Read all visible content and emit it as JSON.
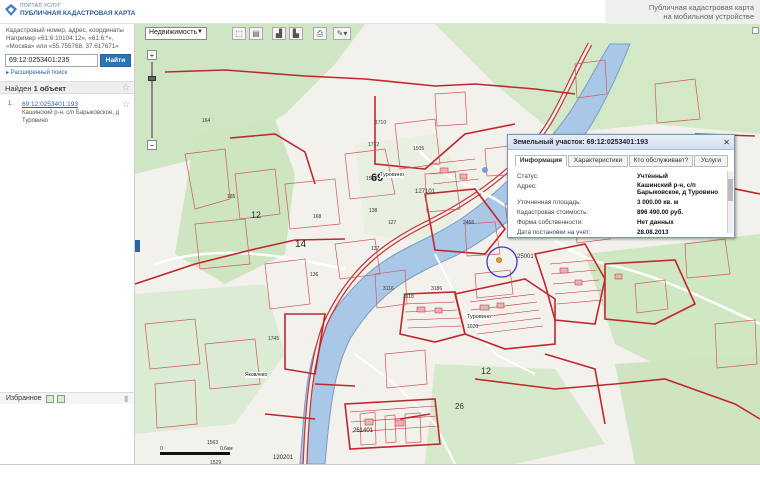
{
  "header": {
    "logo_small": "ПОРТАЛ УСЛУГ",
    "logo_big": "ПУБЛИЧНАЯ КАДАСТРОВАЯ КАРТА",
    "mobile_line1": "Публичная кадастровая карта",
    "mobile_line2": "на мобильном устройстве"
  },
  "search": {
    "hint_line1": "Кадастровый номер, адрес, координаты",
    "hint_line2": "Например «61:6:10104:12», «61:6:*»,",
    "hint_line3": "«Москва» или «55.755768, 37.617671»",
    "value": "69:12:0253401:235",
    "button": "Найти",
    "extended": "▸ Расширенный поиск"
  },
  "results": {
    "found_prefix": "Найден",
    "found_count": "1 объект",
    "item_num": "1.",
    "item_link": "69:12:0253401:193",
    "item_addr1": "Кашинский р-н, с/п Барыковское, д",
    "item_addr2": "Туровино"
  },
  "favorites": {
    "label": "Избранное"
  },
  "toolbar": {
    "layer": "Недвижимость"
  },
  "popup": {
    "title": "Земельный участок: 69:12:0253401:193",
    "tabs": [
      "Информация",
      "Характеристики",
      "Кто обслуживает?",
      "Услуги"
    ],
    "rows": [
      {
        "label": "Статус:",
        "value": "Учтенный"
      },
      {
        "label": "Адрес:",
        "value": "Кашинский р-н, с/п Барыковское, д Туровино"
      },
      {
        "label": "Уточненная площадь:",
        "value": "3 000.00 кв. м"
      },
      {
        "label": "Кадастровая стоимость:",
        "value": "896 490.00 руб."
      },
      {
        "label": "Форма собственности:",
        "value": "Нет данных"
      },
      {
        "label": "Дата постановки на учет:",
        "value": "28.08.2013"
      }
    ]
  },
  "map_labels": {
    "l69": "69",
    "l14": "14",
    "l12a": "12",
    "l12b": "12",
    "l26": "26",
    "turovino": "Туровино",
    "turovino2": "Туровино",
    "l1710": "1710",
    "l1712": "1712",
    "l1564": "1564",
    "l127101": "127101",
    "l165": "165",
    "l164": "164",
    "l168": "168",
    "l137": "137",
    "l138": "138",
    "l127": "127",
    "l2466": "2466",
    "l1020": "1020",
    "l1745": "1745",
    "l261401": "261401",
    "l120201": "120201",
    "l1563": "1563",
    "l1529": "1529",
    "l25001": "25001",
    "l3116": "3116",
    "l3118": "3118",
    "l3186": "3186",
    "l136": "136",
    "l1505": "1505",
    "yakovka": "Яковлево"
  },
  "scale": {
    "left": "0",
    "right": "0.6км"
  }
}
